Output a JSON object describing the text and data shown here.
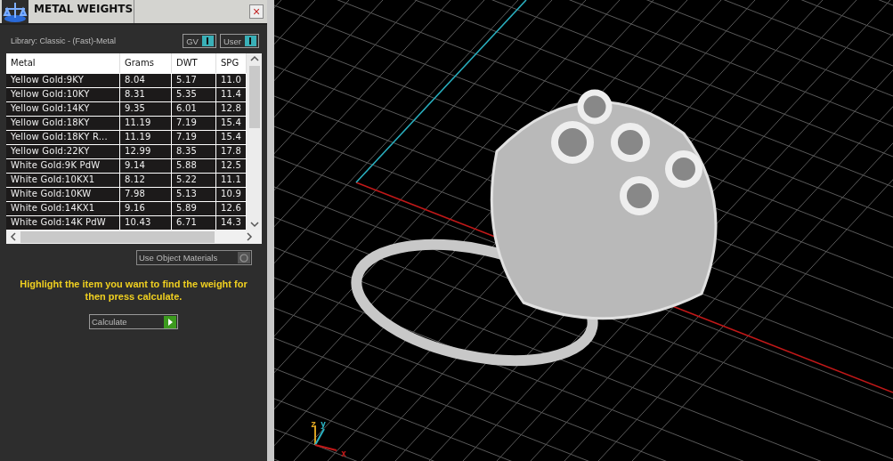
{
  "panel": {
    "title": "METAL WEIGHTS",
    "close": "×",
    "library": "Library: Classic - (Fast)-Metal",
    "toggles": [
      {
        "label": "GV",
        "on": true
      },
      {
        "label": "User",
        "on": true
      }
    ],
    "table": {
      "columns": [
        "Metal",
        "Grams",
        "DWT",
        "SPG"
      ],
      "rows": [
        {
          "cells": [
            "Yellow Gold:9KY",
            "8.04",
            "5.17",
            "11.0"
          ],
          "selected": false
        },
        {
          "cells": [
            "Yellow Gold:10KY",
            "8.31",
            "5.35",
            "11.4"
          ],
          "selected": false
        },
        {
          "cells": [
            "Yellow Gold:14KY",
            "9.35",
            "6.01",
            "12.8"
          ],
          "selected": false
        },
        {
          "cells": [
            "Yellow Gold:18KY",
            "11.19",
            "7.19",
            "15.4"
          ],
          "selected": false
        },
        {
          "cells": [
            "Yellow Gold:18KY R...",
            "11.19",
            "7.19",
            "15.4"
          ],
          "selected": false
        },
        {
          "cells": [
            "Yellow Gold:22KY",
            "12.99",
            "8.35",
            "17.8"
          ],
          "selected": false
        },
        {
          "cells": [
            "White Gold:9K PdW",
            "9.14",
            "5.88",
            "12.5"
          ],
          "selected": false
        },
        {
          "cells": [
            "White Gold:10KX1",
            "8.12",
            "5.22",
            "11.1"
          ],
          "selected": false
        },
        {
          "cells": [
            "White Gold:10KW",
            "7.98",
            "5.13",
            "10.9"
          ],
          "selected": false
        },
        {
          "cells": [
            "White Gold:14KX1",
            "9.16",
            "5.89",
            "12.6"
          ],
          "selected": false
        },
        {
          "cells": [
            "White Gold:14K PdW",
            "10.43",
            "6.71",
            "14.3"
          ],
          "selected": false
        }
      ]
    },
    "use_object_materials": {
      "label": "Use Object Materials",
      "on": false
    },
    "hint": "Highlight the item you want to find the weight for then press calculate.",
    "calculate": "Calculate"
  },
  "viewport": {
    "axes": {
      "z": "z",
      "y": "y",
      "x": "x"
    }
  }
}
